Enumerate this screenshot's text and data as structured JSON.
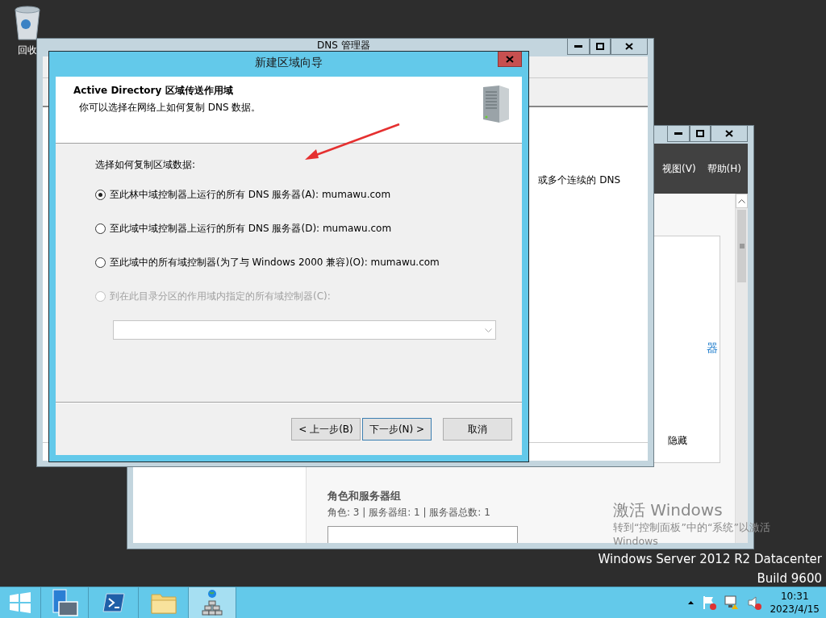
{
  "desktop": {
    "icons": [
      {
        "label": "回收"
      }
    ],
    "edition": "Windows Server 2012 R2 Datacenter",
    "build": "Build 9600",
    "activation": {
      "title": "激活 Windows",
      "message": "转到“控制面板”中的“系统”以激活",
      "message_end": "Windows"
    }
  },
  "server_manager": {
    "menu": [
      "视图(V)",
      "帮助(H)"
    ],
    "link": "器",
    "hide": "隐藏",
    "section_title": "角色和服务器组",
    "section_stats": "角色: 3 | 服务器组: 1 | 服务器总数: 1"
  },
  "dns_manager": {
    "title": "DNS 管理器",
    "text": "或多个连续的 DNS"
  },
  "wizard": {
    "title": "新建区域向导",
    "heading": "Active Directory 区域传送作用域",
    "subheading": "你可以选择在网络上如何复制 DNS 数据。",
    "prompt": "选择如何复制区域数据:",
    "options": [
      {
        "label": "至此林中域控制器上运行的所有 DNS 服务器(A): mumawu.com",
        "selected": true,
        "disabled": false
      },
      {
        "label": "至此域中域控制器上运行的所有 DNS 服务器(D): mumawu.com",
        "selected": false,
        "disabled": false
      },
      {
        "label": "至此域中的所有域控制器(为了与 Windows 2000 兼容)(O): mumawu.com",
        "selected": false,
        "disabled": false
      },
      {
        "label": "到在此目录分区的作用域内指定的所有域控制器(C):",
        "selected": false,
        "disabled": true
      }
    ],
    "buttons": [
      {
        "label": "< 上一步(B)",
        "default": false
      },
      {
        "label": "下一步(N) >",
        "default": true
      },
      {
        "label": "取消",
        "default": false
      }
    ]
  },
  "taskbar": {
    "apps": [
      {
        "kind": "server-manager",
        "selected": false
      },
      {
        "kind": "powershell",
        "selected": false
      },
      {
        "kind": "explorer",
        "selected": false
      },
      {
        "kind": "dns",
        "selected": true
      }
    ],
    "time": "10:31",
    "date": "2023/4/15"
  }
}
